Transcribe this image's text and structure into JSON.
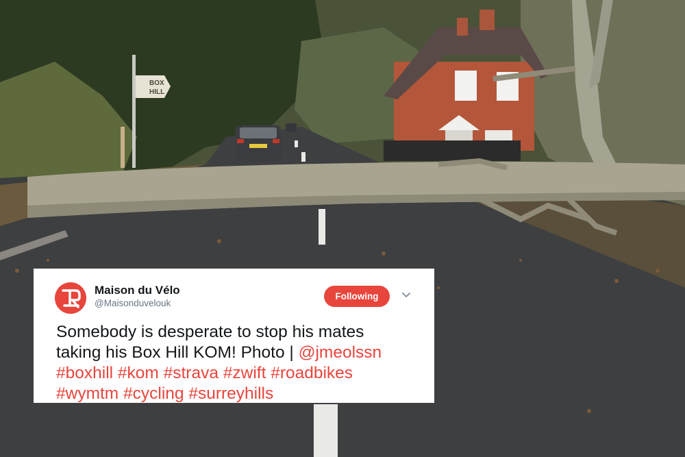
{
  "photo": {
    "signpost_text": [
      "BOX",
      "HILL"
    ],
    "colors": {
      "sky": "#e4e8ea",
      "road": "#3d3f41",
      "trunk": "#a8a48f",
      "brick": "#b5553a",
      "foliage": "#2f3f25"
    }
  },
  "tweet": {
    "name": "Maison du Vélo",
    "handle": "@Maisonduvelouk",
    "follow_label": "Following",
    "text_line1": "Somebody is desperate to stop his mates",
    "text_line2_plain": "taking his Box Hill KOM! Photo | ",
    "text_line2_link": "@jmeolssn",
    "text_line3": "#boxhill #kom #strava #zwift #roadbikes",
    "text_line4": "#wymtm #cycling #surreyhills",
    "accent_color": "#e8453c"
  }
}
